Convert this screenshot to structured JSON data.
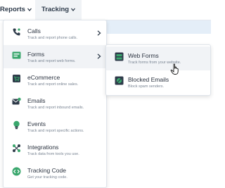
{
  "nav": {
    "reports_label": "Reports",
    "tracking_label": "Tracking"
  },
  "menu": {
    "items": [
      {
        "title": "Calls",
        "desc": "Track and report phone calls.",
        "icon": "phone-icon",
        "has_submenu": true
      },
      {
        "title": "Forms",
        "desc": "Track and report web forms.",
        "icon": "form-icon",
        "has_submenu": true,
        "active": true
      },
      {
        "title": "eCommerce",
        "desc": "Track and report online sales.",
        "icon": "cart-icon",
        "has_submenu": false
      },
      {
        "title": "Emails",
        "desc": "Track and report inbound emails.",
        "icon": "email-icon",
        "has_submenu": false
      },
      {
        "title": "Events",
        "desc": "Track and report specific actions.",
        "icon": "lightbulb-icon",
        "has_submenu": false
      },
      {
        "title": "Integrations",
        "desc": "Track data from tools you use.",
        "icon": "integrations-icon",
        "has_submenu": false
      },
      {
        "title": "Tracking Code",
        "desc": "Get your tracking code.",
        "icon": "code-icon",
        "has_submenu": false
      }
    ]
  },
  "submenu": {
    "items": [
      {
        "title": "Web Forms",
        "desc": "Track forms from your website.",
        "icon": "web-form-icon",
        "hovered": true
      },
      {
        "title": "Blocked Emails",
        "desc": "Block spam senders.",
        "icon": "blocked-email-icon",
        "hovered": false
      }
    ]
  },
  "colors": {
    "icon_green": "#3aa76d",
    "icon_dark": "#2f3b4a",
    "menu_bg": "#ffffff",
    "active_bg": "#f1f3f6",
    "strip_blue": "#e4eef8"
  }
}
